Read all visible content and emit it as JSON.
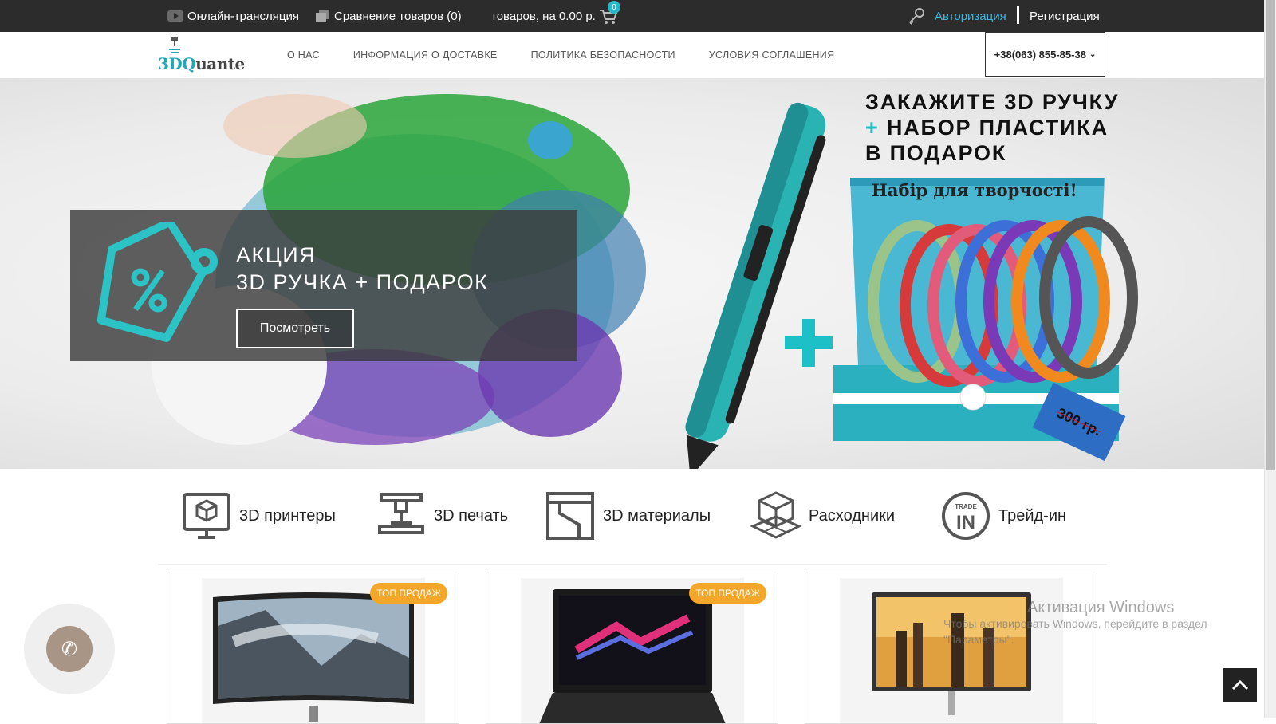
{
  "topbar": {
    "live": "Онлайн-трансляция",
    "compare": "Сравнение товаров (0)",
    "cart": "товаров, на 0.00 р.",
    "cart_count": "0",
    "login": "Авторизация",
    "register": "Регистрация"
  },
  "header": {
    "logo": {
      "prefix": "3D",
      "q": "Q",
      "rest": "uante"
    },
    "nav": [
      "О НАС",
      "ИНФОРМАЦИЯ О ДОСТАВКЕ",
      "ПОЛИТИКА БЕЗОПАСНОСТИ",
      "УСЛОВИЯ СОГЛАШЕНИЯ"
    ],
    "phone": "+38(063) 855-85-38"
  },
  "hero": {
    "promo_line1": "АКЦИЯ",
    "promo_line2": "3D РУЧКА + ПОДАРОК",
    "promo_button": "Посмотреть",
    "headline_line1": "ЗАКАЖИТЕ 3D РУЧКУ",
    "headline_plus": "+",
    "headline_line2": "НАБОР ПЛАСТИКА",
    "headline_line3": "В ПОДАРОК",
    "box_label": "Набір для творчості!",
    "price": "300 гр."
  },
  "categories": [
    "3D принтеры",
    "3D печать",
    "3D материалы",
    "Расходники",
    "Трейд-ин"
  ],
  "products": [
    {
      "badge": "ТОП ПРОДАЖ"
    },
    {
      "badge": "ТОП ПРОДАЖ"
    },
    {
      "badge": ""
    }
  ],
  "watermark": {
    "line1": "Активация Windows",
    "line2": "Чтобы активировать Windows, перейдите в раздел",
    "line3": "\"Параметры\"."
  },
  "colors": {
    "accent": "#29b6c8",
    "topbar": "#2c2c2c",
    "badge": "#f4a62a",
    "link": "#3fb6e0"
  }
}
